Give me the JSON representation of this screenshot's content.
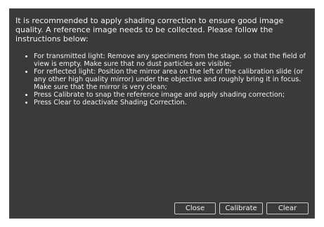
{
  "dialog": {
    "intro": "It is recommended to apply shading correction to ensure good image quality. A reference image needs to be collected. Please follow the instructions below:",
    "instructions": [
      "For transmitted light: Remove any specimens from the stage, so that the field of view is empty. Make sure that no dust particles are visible;",
      "For reflected light: Position the mirror area on the left of the calibration slide (or any other high quality mirror) under the objective and roughly bring it in focus. Make sure that the mirror is very clean;",
      "Press Calibrate to snap the reference image and apply shading correction;",
      "Press Clear to deactivate Shading Correction."
    ],
    "buttons": {
      "close": "Close",
      "calibrate": "Calibrate",
      "clear": "Clear"
    }
  },
  "colors": {
    "dialog_background": "#3a3a3a",
    "text": "#f2f2f2",
    "button_border": "#c9c9c9",
    "page_background": "#ffffff"
  }
}
